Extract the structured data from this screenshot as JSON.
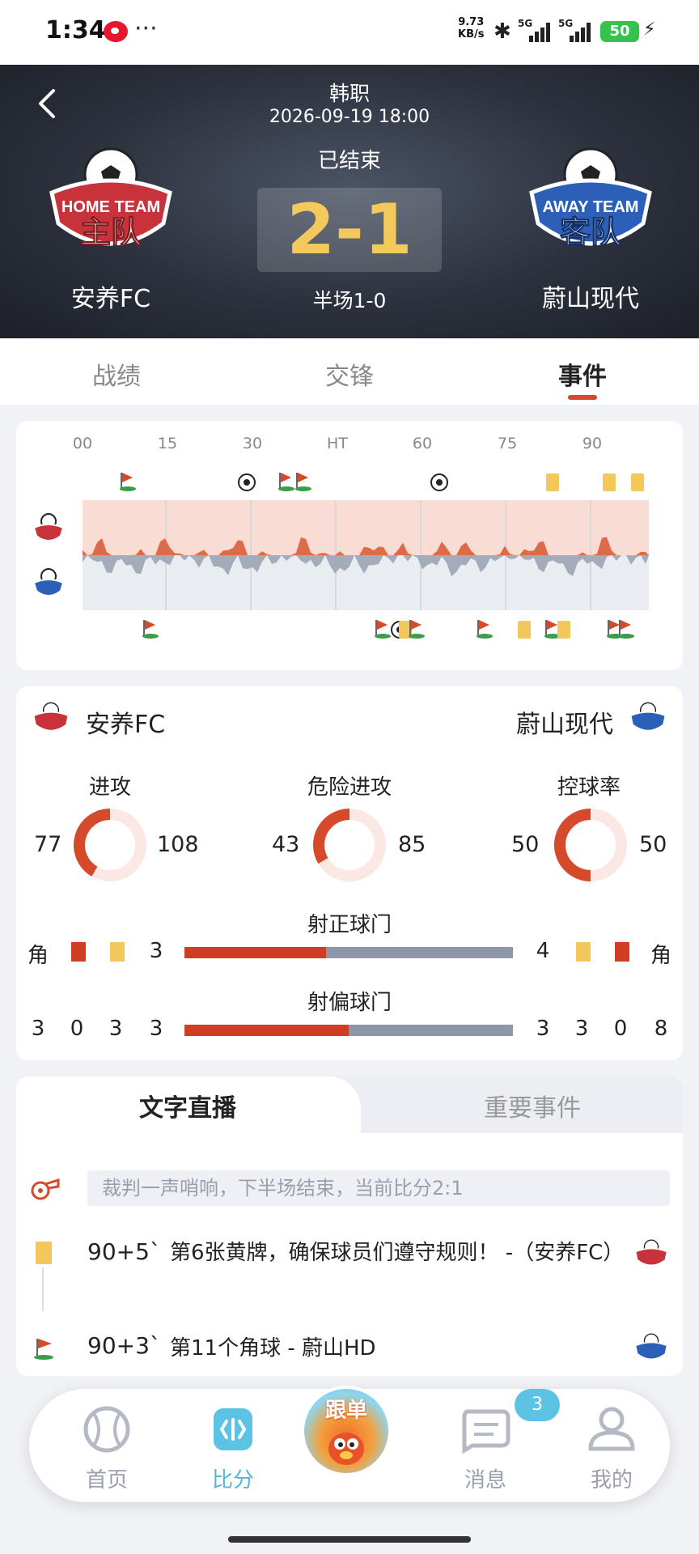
{
  "status": {
    "time": "1:34",
    "speed": "9.73",
    "speed_unit": "KB/s",
    "sig1": "5G",
    "sig2": "5G",
    "battery": "50"
  },
  "match": {
    "league": "韩职",
    "datetime": "2026-09-19 18:00",
    "state": "已结束",
    "score": "2-1",
    "halftime": "半场1-0",
    "home": {
      "name": "安养FC",
      "crest_top": "HOME TEAM",
      "crest_main": "主队",
      "color": "#c8323a"
    },
    "away": {
      "name": "蔚山现代",
      "crest_top": "AWAY TEAM",
      "crest_main": "客队",
      "color": "#2c5fb8"
    }
  },
  "tabs": [
    "战绩",
    "交锋",
    "事件"
  ],
  "active_tab": "事件",
  "timeline": {
    "ticks": [
      "00",
      "15",
      "30",
      "HT",
      "60",
      "75",
      "90"
    ],
    "home_events": [
      {
        "type": "corner",
        "min": 8
      },
      {
        "type": "goal",
        "min": 29
      },
      {
        "type": "corner",
        "min": 36
      },
      {
        "type": "corner",
        "min": 39
      },
      {
        "type": "goal",
        "min": 63
      },
      {
        "type": "yellow",
        "min": 83
      },
      {
        "type": "yellow",
        "min": 93
      },
      {
        "type": "yellow",
        "min": 98
      }
    ],
    "away_events": [
      {
        "type": "corner",
        "min": 12
      },
      {
        "type": "corner",
        "min": 53
      },
      {
        "type": "goal",
        "min": 56
      },
      {
        "type": "yellow",
        "min": 57
      },
      {
        "type": "corner",
        "min": 59
      },
      {
        "type": "corner",
        "min": 71
      },
      {
        "type": "yellow",
        "min": 78
      },
      {
        "type": "corner",
        "min": 83
      },
      {
        "type": "yellow",
        "min": 85
      },
      {
        "type": "corner",
        "min": 94
      },
      {
        "type": "corner",
        "min": 96
      }
    ]
  },
  "stats": {
    "rings": [
      {
        "label": "进攻",
        "home": "77",
        "away": "108",
        "home_share": 0.416
      },
      {
        "label": "危险进攻",
        "home": "43",
        "away": "85",
        "home_share": 0.336
      },
      {
        "label": "控球率",
        "home": "50",
        "away": "50",
        "home_share": 0.5
      }
    ],
    "on_target": {
      "label": "射正球门",
      "home": "3",
      "away": "4",
      "home_share": 0.43
    },
    "off_target": {
      "label": "射偏球门",
      "home": "3",
      "away": "3",
      "home_share": 0.5
    },
    "corner_label": "角",
    "row2": {
      "home": [
        "3",
        "0",
        "3"
      ],
      "away": [
        "3",
        "0",
        "8"
      ]
    },
    "colors": {
      "red": "#cf3e22",
      "yellow": "#f2c75c",
      "grey": "#8e97a8"
    }
  },
  "live": {
    "tabs": [
      "文字直播",
      "重要事件"
    ],
    "referee_text": "裁判一声哨响，下半场结束，当前比分2:1",
    "events": [
      {
        "minute": "90+5`",
        "text": "第6张黄牌，确保球员们遵守规则！ -（安养FC）",
        "icon": "yellow-card-icon",
        "team": "home"
      },
      {
        "minute": "90+3`",
        "text": "第11个角球 - 蔚山HD",
        "icon": "corner-flag-icon",
        "team": "away"
      }
    ]
  },
  "nav": {
    "items": [
      "首页",
      "比分",
      "消息",
      "我的"
    ],
    "center": "跟单",
    "badge": "3",
    "active": "比分"
  }
}
